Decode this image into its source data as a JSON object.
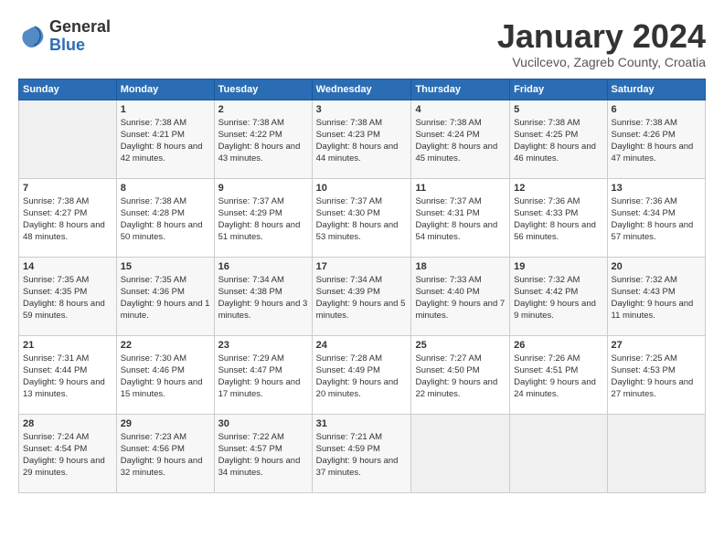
{
  "header": {
    "logo_general": "General",
    "logo_blue": "Blue",
    "month_title": "January 2024",
    "location": "Vucilcevo, Zagreb County, Croatia"
  },
  "columns": [
    "Sunday",
    "Monday",
    "Tuesday",
    "Wednesday",
    "Thursday",
    "Friday",
    "Saturday"
  ],
  "weeks": [
    [
      {
        "day": "",
        "empty": true
      },
      {
        "day": "1",
        "sunrise": "Sunrise: 7:38 AM",
        "sunset": "Sunset: 4:21 PM",
        "daylight": "Daylight: 8 hours and 42 minutes."
      },
      {
        "day": "2",
        "sunrise": "Sunrise: 7:38 AM",
        "sunset": "Sunset: 4:22 PM",
        "daylight": "Daylight: 8 hours and 43 minutes."
      },
      {
        "day": "3",
        "sunrise": "Sunrise: 7:38 AM",
        "sunset": "Sunset: 4:23 PM",
        "daylight": "Daylight: 8 hours and 44 minutes."
      },
      {
        "day": "4",
        "sunrise": "Sunrise: 7:38 AM",
        "sunset": "Sunset: 4:24 PM",
        "daylight": "Daylight: 8 hours and 45 minutes."
      },
      {
        "day": "5",
        "sunrise": "Sunrise: 7:38 AM",
        "sunset": "Sunset: 4:25 PM",
        "daylight": "Daylight: 8 hours and 46 minutes."
      },
      {
        "day": "6",
        "sunrise": "Sunrise: 7:38 AM",
        "sunset": "Sunset: 4:26 PM",
        "daylight": "Daylight: 8 hours and 47 minutes."
      }
    ],
    [
      {
        "day": "7",
        "sunrise": "Sunrise: 7:38 AM",
        "sunset": "Sunset: 4:27 PM",
        "daylight": "Daylight: 8 hours and 48 minutes."
      },
      {
        "day": "8",
        "sunrise": "Sunrise: 7:38 AM",
        "sunset": "Sunset: 4:28 PM",
        "daylight": "Daylight: 8 hours and 50 minutes."
      },
      {
        "day": "9",
        "sunrise": "Sunrise: 7:37 AM",
        "sunset": "Sunset: 4:29 PM",
        "daylight": "Daylight: 8 hours and 51 minutes."
      },
      {
        "day": "10",
        "sunrise": "Sunrise: 7:37 AM",
        "sunset": "Sunset: 4:30 PM",
        "daylight": "Daylight: 8 hours and 53 minutes."
      },
      {
        "day": "11",
        "sunrise": "Sunrise: 7:37 AM",
        "sunset": "Sunset: 4:31 PM",
        "daylight": "Daylight: 8 hours and 54 minutes."
      },
      {
        "day": "12",
        "sunrise": "Sunrise: 7:36 AM",
        "sunset": "Sunset: 4:33 PM",
        "daylight": "Daylight: 8 hours and 56 minutes."
      },
      {
        "day": "13",
        "sunrise": "Sunrise: 7:36 AM",
        "sunset": "Sunset: 4:34 PM",
        "daylight": "Daylight: 8 hours and 57 minutes."
      }
    ],
    [
      {
        "day": "14",
        "sunrise": "Sunrise: 7:35 AM",
        "sunset": "Sunset: 4:35 PM",
        "daylight": "Daylight: 8 hours and 59 minutes."
      },
      {
        "day": "15",
        "sunrise": "Sunrise: 7:35 AM",
        "sunset": "Sunset: 4:36 PM",
        "daylight": "Daylight: 9 hours and 1 minute."
      },
      {
        "day": "16",
        "sunrise": "Sunrise: 7:34 AM",
        "sunset": "Sunset: 4:38 PM",
        "daylight": "Daylight: 9 hours and 3 minutes."
      },
      {
        "day": "17",
        "sunrise": "Sunrise: 7:34 AM",
        "sunset": "Sunset: 4:39 PM",
        "daylight": "Daylight: 9 hours and 5 minutes."
      },
      {
        "day": "18",
        "sunrise": "Sunrise: 7:33 AM",
        "sunset": "Sunset: 4:40 PM",
        "daylight": "Daylight: 9 hours and 7 minutes."
      },
      {
        "day": "19",
        "sunrise": "Sunrise: 7:32 AM",
        "sunset": "Sunset: 4:42 PM",
        "daylight": "Daylight: 9 hours and 9 minutes."
      },
      {
        "day": "20",
        "sunrise": "Sunrise: 7:32 AM",
        "sunset": "Sunset: 4:43 PM",
        "daylight": "Daylight: 9 hours and 11 minutes."
      }
    ],
    [
      {
        "day": "21",
        "sunrise": "Sunrise: 7:31 AM",
        "sunset": "Sunset: 4:44 PM",
        "daylight": "Daylight: 9 hours and 13 minutes."
      },
      {
        "day": "22",
        "sunrise": "Sunrise: 7:30 AM",
        "sunset": "Sunset: 4:46 PM",
        "daylight": "Daylight: 9 hours and 15 minutes."
      },
      {
        "day": "23",
        "sunrise": "Sunrise: 7:29 AM",
        "sunset": "Sunset: 4:47 PM",
        "daylight": "Daylight: 9 hours and 17 minutes."
      },
      {
        "day": "24",
        "sunrise": "Sunrise: 7:28 AM",
        "sunset": "Sunset: 4:49 PM",
        "daylight": "Daylight: 9 hours and 20 minutes."
      },
      {
        "day": "25",
        "sunrise": "Sunrise: 7:27 AM",
        "sunset": "Sunset: 4:50 PM",
        "daylight": "Daylight: 9 hours and 22 minutes."
      },
      {
        "day": "26",
        "sunrise": "Sunrise: 7:26 AM",
        "sunset": "Sunset: 4:51 PM",
        "daylight": "Daylight: 9 hours and 24 minutes."
      },
      {
        "day": "27",
        "sunrise": "Sunrise: 7:25 AM",
        "sunset": "Sunset: 4:53 PM",
        "daylight": "Daylight: 9 hours and 27 minutes."
      }
    ],
    [
      {
        "day": "28",
        "sunrise": "Sunrise: 7:24 AM",
        "sunset": "Sunset: 4:54 PM",
        "daylight": "Daylight: 9 hours and 29 minutes."
      },
      {
        "day": "29",
        "sunrise": "Sunrise: 7:23 AM",
        "sunset": "Sunset: 4:56 PM",
        "daylight": "Daylight: 9 hours and 32 minutes."
      },
      {
        "day": "30",
        "sunrise": "Sunrise: 7:22 AM",
        "sunset": "Sunset: 4:57 PM",
        "daylight": "Daylight: 9 hours and 34 minutes."
      },
      {
        "day": "31",
        "sunrise": "Sunrise: 7:21 AM",
        "sunset": "Sunset: 4:59 PM",
        "daylight": "Daylight: 9 hours and 37 minutes."
      },
      {
        "day": "",
        "empty": true
      },
      {
        "day": "",
        "empty": true
      },
      {
        "day": "",
        "empty": true
      }
    ]
  ]
}
